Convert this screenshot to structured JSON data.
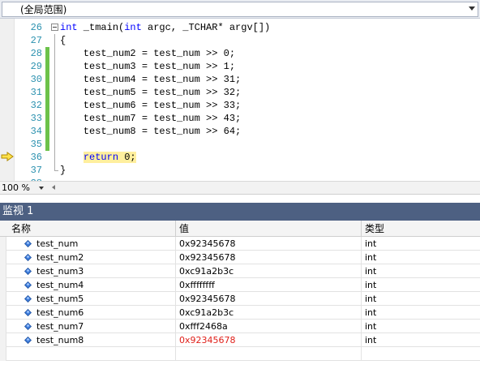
{
  "scope": {
    "label": "(全局范围)"
  },
  "editor": {
    "lines": [
      {
        "num": "26",
        "code": "int _tmain(int argc, _TCHAR* argv[])",
        "fold": "box",
        "bar": "none"
      },
      {
        "num": "27",
        "code": "{",
        "fold": "vline",
        "bar": "none"
      },
      {
        "num": "28",
        "code": "    test_num2 = test_num >> 0;",
        "fold": "vline",
        "bar": "saved"
      },
      {
        "num": "29",
        "code": "    test_num3 = test_num >> 1;",
        "fold": "vline",
        "bar": "saved"
      },
      {
        "num": "30",
        "code": "    test_num4 = test_num >> 31;",
        "fold": "vline",
        "bar": "saved"
      },
      {
        "num": "31",
        "code": "    test_num5 = test_num >> 32;",
        "fold": "vline",
        "bar": "saved"
      },
      {
        "num": "32",
        "code": "    test_num6 = test_num >> 33;",
        "fold": "vline",
        "bar": "saved"
      },
      {
        "num": "33",
        "code": "    test_num7 = test_num >> 43;",
        "fold": "vline",
        "bar": "saved"
      },
      {
        "num": "34",
        "code": "    test_num8 = test_num >> 64;",
        "fold": "vline",
        "bar": "saved"
      },
      {
        "num": "35",
        "code": "",
        "fold": "vline",
        "bar": "saved"
      },
      {
        "num": "36",
        "code": "    return 0;",
        "fold": "vline",
        "bar": "none",
        "current": true
      },
      {
        "num": "37",
        "code": "}",
        "fold": "endl",
        "bar": "none"
      },
      {
        "num": "38",
        "code": "",
        "fold": "none",
        "bar": "none"
      }
    ],
    "execution_arrow_icon": "current-statement-arrow-icon"
  },
  "zoom": {
    "value": "100 %"
  },
  "watch": {
    "title": "监视 1",
    "headers": {
      "name": "名称",
      "value": "值",
      "type": "类型"
    },
    "rows": [
      {
        "name": "test_num",
        "value": "0x92345678",
        "type": "int",
        "changed": false
      },
      {
        "name": "test_num2",
        "value": "0x92345678",
        "type": "int",
        "changed": false
      },
      {
        "name": "test_num3",
        "value": "0xc91a2b3c",
        "type": "int",
        "changed": false
      },
      {
        "name": "test_num4",
        "value": "0xffffffff",
        "type": "int",
        "changed": false
      },
      {
        "name": "test_num5",
        "value": "0x92345678",
        "type": "int",
        "changed": false
      },
      {
        "name": "test_num6",
        "value": "0xc91a2b3c",
        "type": "int",
        "changed": false
      },
      {
        "name": "test_num7",
        "value": "0xfff2468a",
        "type": "int",
        "changed": false
      },
      {
        "name": "test_num8",
        "value": "0x92345678",
        "type": "int",
        "changed": true
      }
    ],
    "colors": {
      "changed_value": "#e0201a",
      "title_bar": "#4d6082",
      "current_line": "#ffef9e",
      "saved_change_bar": "#6cc24a"
    }
  }
}
